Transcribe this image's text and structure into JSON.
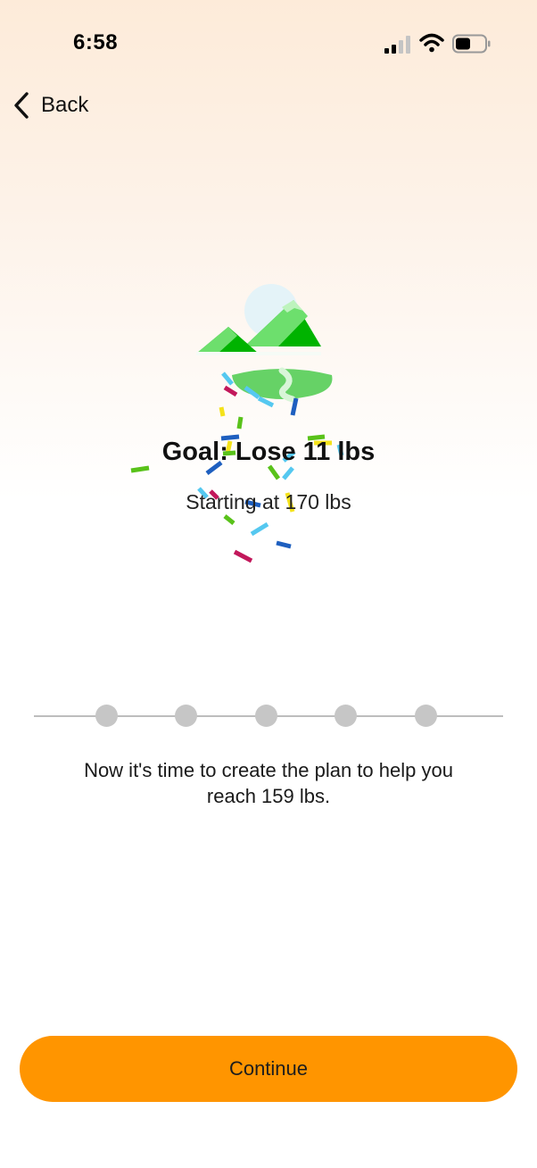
{
  "status_bar": {
    "time": "6:58",
    "signal_icon": "cellular-signal-icon",
    "wifi_icon": "wifi-icon",
    "battery_icon": "battery-icon"
  },
  "nav": {
    "back_label": "Back",
    "back_icon": "chevron-left-icon"
  },
  "hero": {
    "illustration": "mountain-landscape-with-confetti"
  },
  "goal": {
    "title": "Goal: Lose 11 lbs",
    "subtitle": "Starting at 170 lbs"
  },
  "stepper": {
    "steps": [
      {
        "name": "step-1"
      },
      {
        "name": "step-2"
      },
      {
        "name": "step-3"
      },
      {
        "name": "step-4"
      },
      {
        "name": "step-5"
      }
    ]
  },
  "plan": {
    "message": "Now it's time to create the plan to help you reach 159 lbs."
  },
  "footer": {
    "continue_label": "Continue"
  },
  "colors": {
    "accent": "#ff9500",
    "mountain_green": "#00b300",
    "mountain_light": "#6ddf6d",
    "step_dot": "#c6c6c6",
    "confetti": [
      "#55c8f0",
      "#c2185b",
      "#1e5fbf",
      "#f4e21a",
      "#59c21a"
    ]
  }
}
